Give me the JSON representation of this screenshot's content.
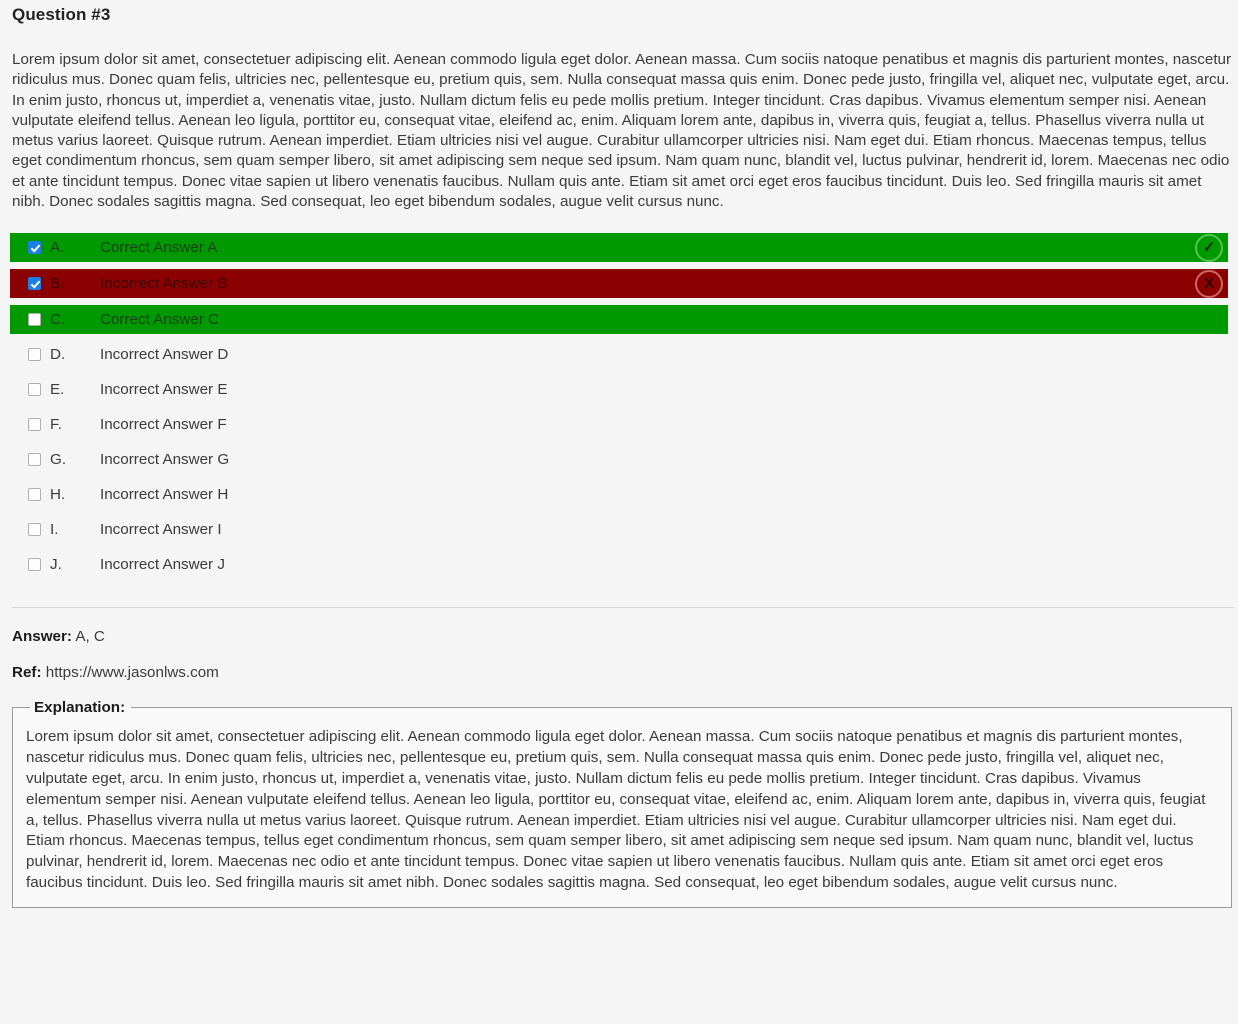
{
  "question": {
    "title": "Question #3",
    "body": "Lorem ipsum dolor sit amet, consectetuer adipiscing elit. Aenean commodo ligula eget dolor. Aenean massa. Cum sociis natoque penatibus et magnis dis parturient montes, nascetur ridiculus mus. Donec quam felis, ultricies nec, pellentesque eu, pretium quis, sem. Nulla consequat massa quis enim. Donec pede justo, fringilla vel, aliquet nec, vulputate eget, arcu. In enim justo, rhoncus ut, imperdiet a, venenatis vitae, justo. Nullam dictum felis eu pede mollis pretium. Integer tincidunt. Cras dapibus. Vivamus elementum semper nisi. Aenean vulputate eleifend tellus. Aenean leo ligula, porttitor eu, consequat vitae, eleifend ac, enim. Aliquam lorem ante, dapibus in, viverra quis, feugiat a, tellus. Phasellus viverra nulla ut metus varius laoreet. Quisque rutrum. Aenean imperdiet. Etiam ultricies nisi vel augue. Curabitur ullamcorper ultricies nisi. Nam eget dui. Etiam rhoncus. Maecenas tempus, tellus eget condimentum rhoncus, sem quam semper libero, sit amet adipiscing sem neque sed ipsum. Nam quam nunc, blandit vel, luctus pulvinar, hendrerit id, lorem. Maecenas nec odio et ante tincidunt tempus. Donec vitae sapien ut libero venenatis faucibus. Nullam quis ante. Etiam sit amet orci eget eros faucibus tincidunt. Duis leo. Sed fringilla mauris sit amet nibh. Donec sodales sagittis magna. Sed consequat, leo eget bibendum sodales, augue velit cursus nunc."
  },
  "choices": [
    {
      "letter": "A.",
      "text": "Correct Answer A",
      "checked": true,
      "state": "correct",
      "mark": "check-icon",
      "mark_glyph": "✓"
    },
    {
      "letter": "B.",
      "text": "Incorrect Answer B",
      "checked": true,
      "state": "incorrect",
      "mark": "cross-icon",
      "mark_glyph": "X"
    },
    {
      "letter": "C.",
      "text": "Correct Answer C",
      "checked": false,
      "state": "correct",
      "mark": "none",
      "mark_glyph": ""
    },
    {
      "letter": "D.",
      "text": "Incorrect Answer D",
      "checked": false,
      "state": "plain",
      "mark": "none",
      "mark_glyph": ""
    },
    {
      "letter": "E.",
      "text": "Incorrect Answer E",
      "checked": false,
      "state": "plain",
      "mark": "none",
      "mark_glyph": ""
    },
    {
      "letter": "F.",
      "text": "Incorrect Answer F",
      "checked": false,
      "state": "plain",
      "mark": "none",
      "mark_glyph": ""
    },
    {
      "letter": "G.",
      "text": "Incorrect Answer G",
      "checked": false,
      "state": "plain",
      "mark": "none",
      "mark_glyph": ""
    },
    {
      "letter": "H.",
      "text": "Incorrect Answer H",
      "checked": false,
      "state": "plain",
      "mark": "none",
      "mark_glyph": ""
    },
    {
      "letter": "I.",
      "text": "Incorrect Answer I",
      "checked": false,
      "state": "plain",
      "mark": "none",
      "mark_glyph": ""
    },
    {
      "letter": "J.",
      "text": "Incorrect Answer J",
      "checked": false,
      "state": "plain",
      "mark": "none",
      "mark_glyph": ""
    }
  ],
  "answer": {
    "label": "Answer:",
    "value": "A, C"
  },
  "reference": {
    "label": "Ref:",
    "value": "https://www.jasonlws.com"
  },
  "explanation": {
    "legend": "Explanation:",
    "text": "Lorem ipsum dolor sit amet, consectetuer adipiscing elit. Aenean commodo ligula eget dolor. Aenean massa. Cum sociis natoque penatibus et magnis dis parturient montes, nascetur ridiculus mus. Donec quam felis, ultricies nec, pellentesque eu, pretium quis, sem. Nulla consequat massa quis enim. Donec pede justo, fringilla vel, aliquet nec, vulputate eget, arcu. In enim justo, rhoncus ut, imperdiet a, venenatis vitae, justo. Nullam dictum felis eu pede mollis pretium. Integer tincidunt. Cras dapibus. Vivamus elementum semper nisi. Aenean vulputate eleifend tellus. Aenean leo ligula, porttitor eu, consequat vitae, eleifend ac, enim. Aliquam lorem ante, dapibus in, viverra quis, feugiat a, tellus. Phasellus viverra nulla ut metus varius laoreet. Quisque rutrum. Aenean imperdiet. Etiam ultricies nisi vel augue. Curabitur ullamcorper ultricies nisi. Nam eget dui. Etiam rhoncus. Maecenas tempus, tellus eget condimentum rhoncus, sem quam semper libero, sit amet adipiscing sem neque sed ipsum. Nam quam nunc, blandit vel, luctus pulvinar, hendrerit id, lorem. Maecenas nec odio et ante tincidunt tempus. Donec vitae sapien ut libero venenatis faucibus. Nullam quis ante. Etiam sit amet orci eget eros faucibus tincidunt. Duis leo. Sed fringilla mauris sit amet nibh. Donec sodales sagittis magna. Sed consequat, leo eget bibendum sodales, augue velit cursus nunc."
  },
  "colors": {
    "correct_bg": "#009900",
    "incorrect_bg": "#8b0000",
    "checkbox_checked": "#1a7fe8",
    "page_bg": "#f5f5f5"
  }
}
